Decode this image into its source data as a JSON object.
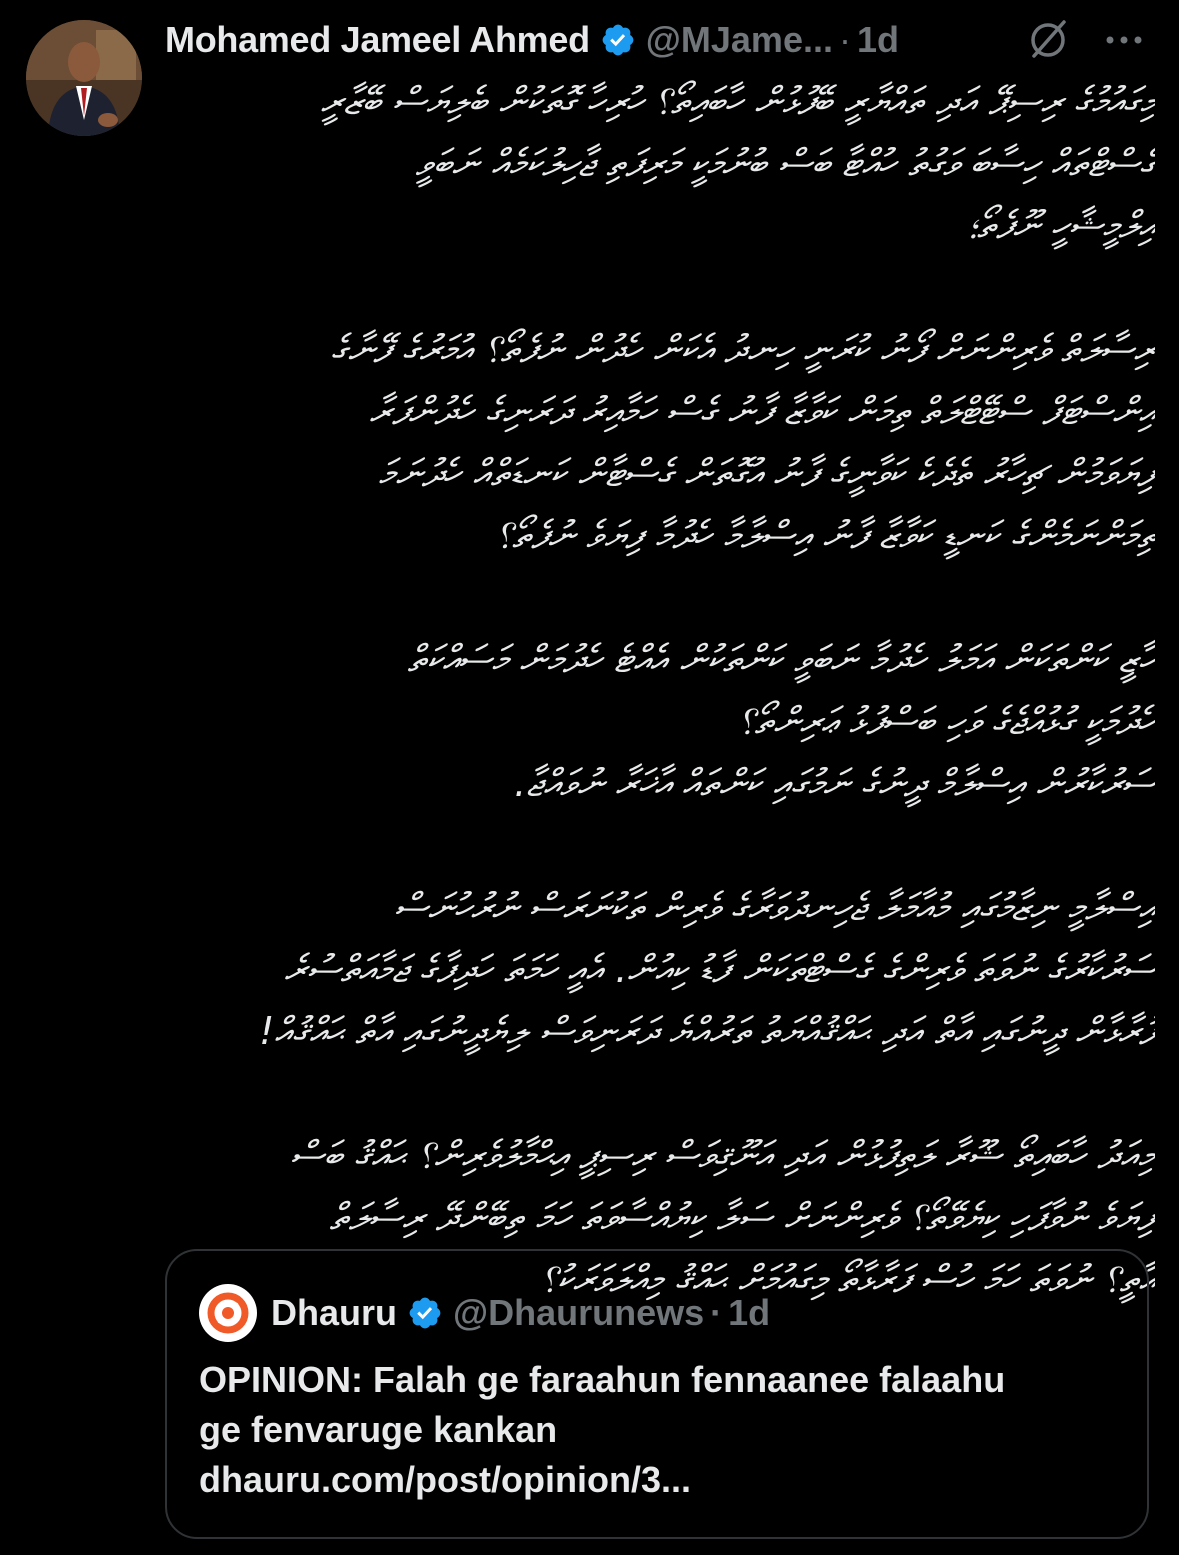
{
  "tweet": {
    "author": {
      "display_name": "Mohamed Jameel Ahmed",
      "handle": "@MJame...",
      "verified": true,
      "avatar_icon": "profile-photo"
    },
    "separator": "·",
    "time": "1d",
    "icons": {
      "grok": "grok-icon",
      "more": "more-options-icon"
    },
    "body_paragraphs": [
      [
        "މިގައުމުގެ ރިސިޕޭ އަދި ތައްޔާރީ ބޭފުޅުން ހާބައިތޯ؟ ހުރިހާ ގޮތަކުން ބެލިޔަސް ބޭޒާރީ",
        "ގެސްޓްތައް ހިސާބަ ވަގުތު ހުއްޓާ ބަސް ބުނުމަކީ މަރިފަތި ޖާހިލުކަމެއް ނަބަވީ",
        "އިލްމީޝާހީ ނޫފެތޯ؛"
      ],
      [
        "ރިސާލަތް ވެރިންނަށް ފޯނު ކުރަނީ ހިނދު އެކަން ހެދުން ނުފެތޯ؟ އުމަރުގެ ފޭނާގެ",
        "އިންސްޓަފް ސްޓޭޓްލަތް ތިމަން ކަވާޒާ ފާނު ގެސް ހަމާއިރު ދަރަނިގެ ހެދުންފަރާ",
        "ފިޔަވަމުން ޗިހާރު ތެދެކެ ކަވާނީގެ ފާނު އުގޮތަން ގެސްޓާން ކަނޑަތްއް ހެދުނަމަ",
        "ތިމަންނަމެންގެ ކަނޑީ ކަވާޒާ ފާނު އިސްލާމާ ހެދުމާ ފިޔަވެ ނުފެތޯ؟"
      ],
      [
        "ހާޒީ ކަންތަކަން އަމަލު ހެދުމާ ނަބަވީ ކަންތަކުން އެއްޓެ ހެދުމަން މަސައްކަތް",
        "ހެދުމަކީ ގުޅުއްޖެގެ ވަހި ބަސްފުޅު ޢަރިންތޯ؟",
        "ސަރުކާރުން އިސްލާމް ދީނުގެ ނަމުގައި ކަންތައް އާޚަރާ ނުވައްޖާ."
      ],
      [
        "އިސްލާމީ ނިޒާމުގައި މުއާމަލާ ޖެހިނދުވަރާގެ ވެރިން ތަކުނަރަސް ނުރުހުނަސް",
        "ސަރުކާރުގެ ނުވަތަ ވެރިންގެ ގެސްޓްތަކަން ފާޑު ކިއުން. އެއީ ހަމަތަ ހަދިފާގެ ޖަމާއަތްސުރެ",
        "ފުރާޅާން ދީނުގައި އާތް އަދި ޙައްޤުއްޔަތު ތަރުއްޔެ ދަރަނިވަސް ލިޔެދީނުގައި އާތް ޙައްޤުއް!"
      ],
      [
        "މިއަދު ހާބައިތޯ ޝޫރާ ލަތިފުޅުން އަދި އަނޫޤިވަސް ރިސިޕީ އިޙްމާލުވެރިން؟ ޙައްޤު ބަސް",
        "ފިޔަވެ ނުވާފަހި ކިޔެވޭތޯ؟ ވެރިންނަށް ސަލާ ކިޔުއްސާވަތަ ހަމަ ތިބޭންދޭ ރިސާލަތް",
        "އާތީ؟ ނުވަތަ ހަމަ ހުސް ފަރާޅާތޯ މިގައުމަށް ޙައްޤު މިއްލަވަރަކު؟"
      ]
    ],
    "quote": {
      "author": {
        "display_name": "Dhauru",
        "handle": "@Dhaurunews",
        "verified": true,
        "avatar_icon": "dhauru-logo-icon"
      },
      "separator": "·",
      "time": "1d",
      "text_lines": [
        "OPINION: Falah ge faraahun fennaanee falaahu",
        "ge fenvaruge kankan",
        "dhauru.com/post/opinion/3..."
      ]
    }
  },
  "colors": {
    "background": "#000000",
    "text_primary": "#e7e9ea",
    "text_secondary": "#71767b",
    "verified_blue": "#1d9bf0",
    "card_border": "#2f3336",
    "dhauru_orange": "#f05a28"
  }
}
